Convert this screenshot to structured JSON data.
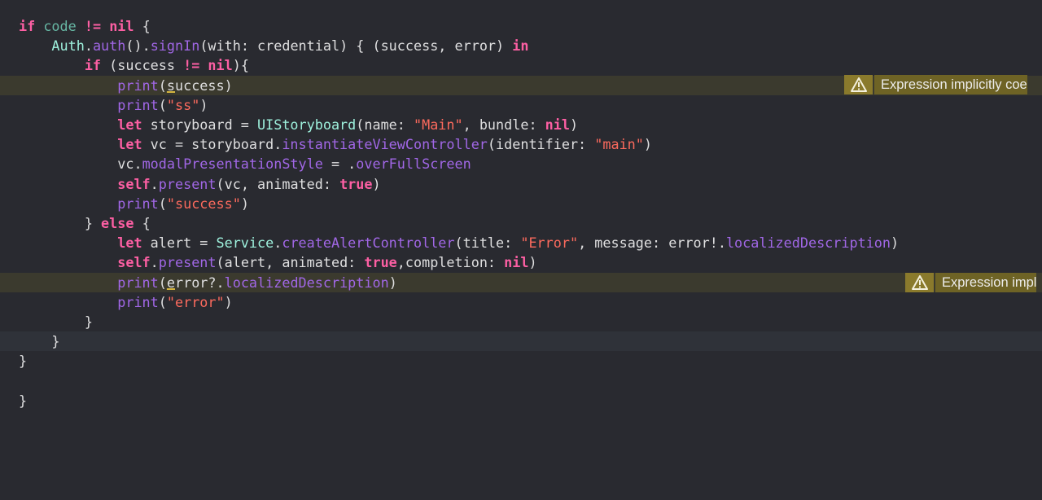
{
  "colors": {
    "background": "#292a30",
    "keyword": "#fc5fa3",
    "string": "#fc6a5d",
    "function": "#a167e6",
    "type": "#9ef1dd",
    "variable": "#67b7a4",
    "warning_highlight": "#3b3a2e",
    "warning_badge": "#6e6325"
  },
  "code_lines": [
    {
      "indent": "",
      "tokens": [
        [
          "kw",
          "if"
        ],
        [
          "plain",
          " "
        ],
        [
          "var",
          "code"
        ],
        [
          "plain",
          " "
        ],
        [
          "kw",
          "!="
        ],
        [
          "plain",
          " "
        ],
        [
          "kw",
          "nil"
        ],
        [
          "plain",
          " {"
        ]
      ]
    },
    {
      "indent": "    ",
      "tokens": [
        [
          "typ",
          "Auth"
        ],
        [
          "plain",
          "."
        ],
        [
          "fn",
          "auth"
        ],
        [
          "plain",
          "()."
        ],
        [
          "fn",
          "signIn"
        ],
        [
          "plain",
          "(with: credential) { (success, error) "
        ],
        [
          "kw",
          "in"
        ]
      ]
    },
    {
      "indent": "        ",
      "tokens": [
        [
          "kw",
          "if"
        ],
        [
          "plain",
          " (success "
        ],
        [
          "kw",
          "!="
        ],
        [
          "plain",
          " "
        ],
        [
          "kw",
          "nil"
        ],
        [
          "plain",
          "){"
        ]
      ]
    },
    {
      "indent": "            ",
      "tokens": [
        [
          "fn",
          "print"
        ],
        [
          "plain",
          "("
        ],
        [
          "ul",
          "s"
        ],
        [
          "plain",
          "uccess)"
        ]
      ]
    },
    {
      "indent": "            ",
      "tokens": [
        [
          "fn",
          "print"
        ],
        [
          "plain",
          "("
        ],
        [
          "str",
          "\"ss\""
        ],
        [
          "plain",
          ")"
        ]
      ]
    },
    {
      "indent": "            ",
      "tokens": [
        [
          "kw",
          "let"
        ],
        [
          "plain",
          " storyboard = "
        ],
        [
          "typ",
          "UIStoryboard"
        ],
        [
          "plain",
          "(name: "
        ],
        [
          "str",
          "\"Main\""
        ],
        [
          "plain",
          ", bundle: "
        ],
        [
          "kw",
          "nil"
        ],
        [
          "plain",
          ")"
        ]
      ]
    },
    {
      "indent": "            ",
      "tokens": [
        [
          "kw",
          "let"
        ],
        [
          "plain",
          " vc = storyboard."
        ],
        [
          "fn",
          "instantiateViewController"
        ],
        [
          "plain",
          "(identifier: "
        ],
        [
          "str",
          "\"main\""
        ],
        [
          "plain",
          ")"
        ]
      ]
    },
    {
      "indent": "            ",
      "tokens": [
        [
          "plain",
          "vc."
        ],
        [
          "prop",
          "modalPresentationStyle"
        ],
        [
          "plain",
          " = ."
        ],
        [
          "prop",
          "overFullScreen"
        ]
      ]
    },
    {
      "indent": "            ",
      "tokens": [
        [
          "kw",
          "self"
        ],
        [
          "plain",
          "."
        ],
        [
          "fn",
          "present"
        ],
        [
          "plain",
          "(vc, animated: "
        ],
        [
          "kw",
          "true"
        ],
        [
          "plain",
          ")"
        ]
      ]
    },
    {
      "indent": "            ",
      "tokens": [
        [
          "fn",
          "print"
        ],
        [
          "plain",
          "("
        ],
        [
          "str",
          "\"success\""
        ],
        [
          "plain",
          ")"
        ]
      ]
    },
    {
      "indent": "        ",
      "tokens": [
        [
          "plain",
          "} "
        ],
        [
          "kw",
          "else"
        ],
        [
          "plain",
          " {"
        ]
      ]
    },
    {
      "indent": "            ",
      "tokens": [
        [
          "kw",
          "let"
        ],
        [
          "plain",
          " alert = "
        ],
        [
          "typ",
          "Service"
        ],
        [
          "plain",
          "."
        ],
        [
          "fn",
          "createAlertController"
        ],
        [
          "plain",
          "(title: "
        ],
        [
          "str",
          "\"Error\""
        ],
        [
          "plain",
          ", message: error!."
        ],
        [
          "prop",
          "localizedDescription"
        ],
        [
          "plain",
          ")"
        ]
      ]
    },
    {
      "indent": "            ",
      "tokens": [
        [
          "kw",
          "self"
        ],
        [
          "plain",
          "."
        ],
        [
          "fn",
          "present"
        ],
        [
          "plain",
          "(alert, animated: "
        ],
        [
          "kw",
          "true"
        ],
        [
          "plain",
          ",completion: "
        ],
        [
          "kw",
          "nil"
        ],
        [
          "plain",
          ")"
        ]
      ]
    },
    {
      "indent": "            ",
      "tokens": [
        [
          "fn",
          "print"
        ],
        [
          "plain",
          "("
        ],
        [
          "ul",
          "e"
        ],
        [
          "plain",
          "rror?."
        ],
        [
          "prop",
          "localizedDescription"
        ],
        [
          "plain",
          ")"
        ]
      ]
    },
    {
      "indent": "            ",
      "tokens": [
        [
          "fn",
          "print"
        ],
        [
          "plain",
          "("
        ],
        [
          "str",
          "\"error\""
        ],
        [
          "plain",
          ")"
        ]
      ]
    },
    {
      "indent": "        ",
      "tokens": [
        [
          "plain",
          "}"
        ]
      ]
    },
    {
      "indent": "    ",
      "tokens": [
        [
          "plain",
          "}"
        ]
      ]
    },
    {
      "indent": "",
      "tokens": [
        [
          "plain",
          "}"
        ]
      ]
    },
    {
      "indent": "",
      "tokens": []
    },
    {
      "indent": "",
      "tokens": [
        [
          "plain",
          "}"
        ]
      ]
    }
  ],
  "warnings": [
    {
      "line": 4,
      "text": "Expression implicitly coe"
    },
    {
      "line": 14,
      "text": "Expression impl"
    }
  ]
}
